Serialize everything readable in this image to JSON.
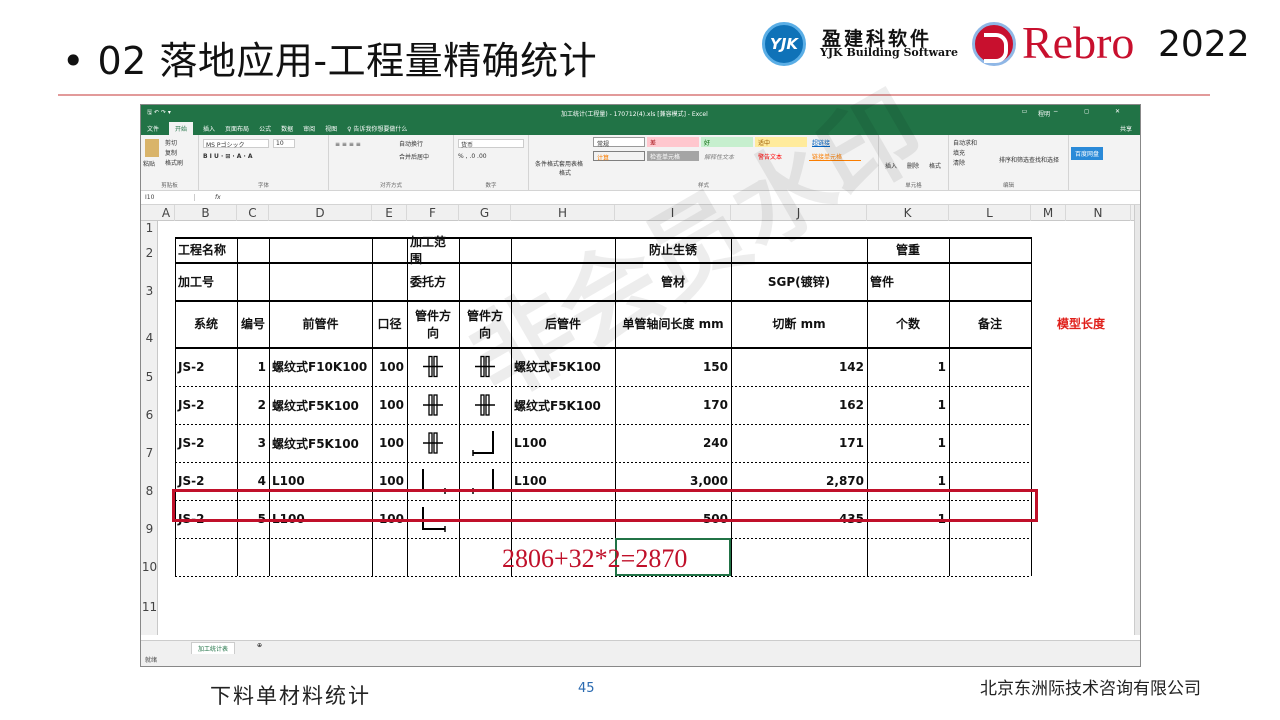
{
  "slide": {
    "title": "• 02 落地应用-工程量精确统计",
    "page_number": "45",
    "footer_left": "下料单材料统计",
    "footer_right": "北京东洲际技术咨询有限公司",
    "annotation": "2806+32*2=2870",
    "watermark": "非会员水印"
  },
  "logos": {
    "yjk_mark": "YJK",
    "yjk_cn": "盈建科软件",
    "yjk_en": "YJK Building Software",
    "rebro": "Rebro",
    "year": "2022"
  },
  "excel": {
    "title": "加工统计(工程量) - 170712(4).xls [兼容模式] - Excel",
    "user": "程明",
    "tabs": [
      "文件",
      "开始",
      "插入",
      "页面布局",
      "公式",
      "数据",
      "审阅",
      "视图",
      "♀ 告诉我你想要做什么"
    ],
    "share": "共享",
    "name_box": "I10",
    "fx": "fx",
    "ribbon": {
      "paste": "粘贴",
      "cut": "剪切",
      "copy": "复制",
      "format_painter": "格式刷",
      "clipboard": "剪贴板",
      "font_name": "MS Pゴシック",
      "font_size": "10",
      "font": "字体",
      "wrap": "自动换行",
      "merge": "合并后居中",
      "align": "对齐方式",
      "num_fmt": "货币",
      "number": "数字",
      "cond": "条件格式",
      "table_fmt": "套用表格格式",
      "styles": "样式",
      "normal": "常规",
      "bad": "差",
      "good": "好",
      "neutral": "适中",
      "hyperlink": "超链接",
      "calc": "计算",
      "check_cell": "检查单元格",
      "explanatory": "解释性文本",
      "warning": "警告文本",
      "linked": "链接单元格",
      "insert": "插入",
      "delete": "删除",
      "format": "格式",
      "cells": "单元格",
      "autosum": "自动求和",
      "fill": "填充",
      "clear": "清除",
      "sort": "排序和筛选",
      "find": "查找和选择",
      "editing": "编辑",
      "upload": "百度网盘"
    },
    "columns": [
      "A",
      "B",
      "C",
      "D",
      "E",
      "F",
      "G",
      "H",
      "I",
      "J",
      "K",
      "L",
      "M",
      "N"
    ],
    "rows": [
      "1",
      "2",
      "3",
      "4",
      "5",
      "6",
      "7",
      "8",
      "9",
      "10",
      "11"
    ],
    "sheet_tab": "加工统计表",
    "status": "就绪",
    "cells": {
      "r2": {
        "b": "工程名称",
        "f": "加工范围",
        "i": "防止生锈",
        "k": "管重"
      },
      "r3": {
        "b": "加工号",
        "f": "委托方",
        "i": "管材",
        "j": "SGP(镀锌)",
        "k": "管件"
      },
      "header": {
        "sys": "系统",
        "no": "编号",
        "front": "前管件",
        "dia": "口径",
        "dir1": "管件方向",
        "dir2": "管件方向",
        "back": "后管件",
        "len": "单管轴间长度 mm",
        "cut": "切断 mm",
        "qty": "个数",
        "note": "备注",
        "model_len": "模型长度"
      },
      "data": [
        {
          "sys": "JS-2",
          "no": "1",
          "front": "螺纹式F10K100",
          "dia": "100",
          "back": "螺纹式F5K100",
          "len": "150",
          "cut": "142",
          "qty": "1"
        },
        {
          "sys": "JS-2",
          "no": "2",
          "front": "螺纹式F5K100",
          "dia": "100",
          "back": "螺纹式F5K100",
          "len": "170",
          "cut": "162",
          "qty": "1"
        },
        {
          "sys": "JS-2",
          "no": "3",
          "front": "螺纹式F5K100",
          "dia": "100",
          "back": "L100",
          "len": "240",
          "cut": "171",
          "qty": "1"
        },
        {
          "sys": "JS-2",
          "no": "4",
          "front": "L100",
          "dia": "100",
          "back": "L100",
          "len": "3,000",
          "cut": "2,870",
          "qty": "1"
        },
        {
          "sys": "JS-2",
          "no": "5",
          "front": "L100",
          "dia": "100",
          "back": "",
          "len": "500",
          "cut": "435",
          "qty": "1"
        }
      ]
    }
  },
  "colors": {
    "excel_green": "#217346",
    "highlight_red": "#c0102a",
    "rebro_red": "#c8102e",
    "yjk_blue": "#0f72b8"
  }
}
